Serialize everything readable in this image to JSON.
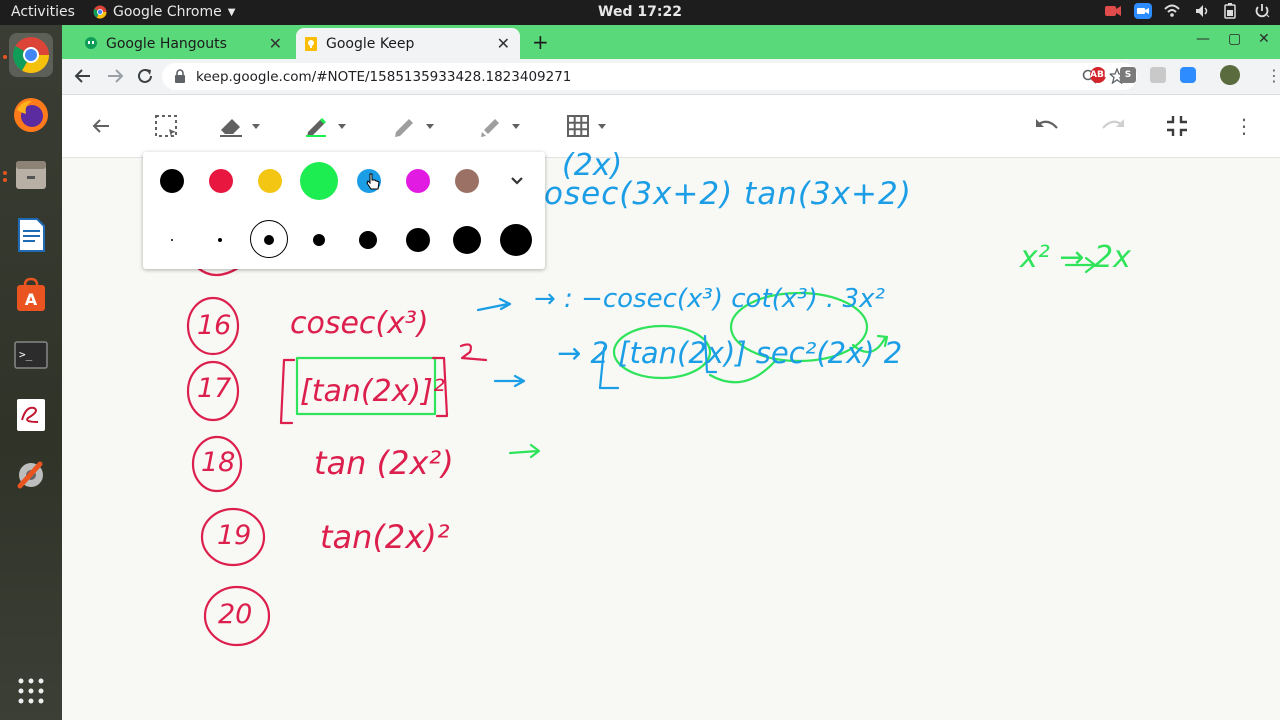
{
  "system": {
    "activities_label": "Activities",
    "app_menu_label": "Google Chrome",
    "clock": "Wed 17:22"
  },
  "browser": {
    "tabs": [
      {
        "title": "Google Hangouts",
        "close": "✕"
      },
      {
        "title": "Google Keep",
        "close": "✕"
      }
    ],
    "new_tab_label": "+",
    "url": "keep.google.com/#NOTE/1585135933428.1823409271",
    "extensions": [
      "ABP",
      "S"
    ]
  },
  "color_picker": {
    "colors": [
      "#000000",
      "#e8173f",
      "#f3c614",
      "#1ded50",
      "#1b9ee6",
      "#e11be1",
      "#9c7165"
    ],
    "selected_color": "#1ded50",
    "stroke_sizes": [
      2,
      4,
      10,
      12,
      18,
      24,
      28,
      32
    ],
    "selected_size_index": 2,
    "expand_icon": "chevron-down-icon"
  },
  "note": {
    "red_lines": [
      {
        "number": "16",
        "expr": "cosec(x³)"
      },
      {
        "number": "17",
        "expr": "[tan(2x)]²"
      },
      {
        "number": "18",
        "expr": "tan (2x²)"
      },
      {
        "number": "19",
        "expr": "tan(2x)²"
      },
      {
        "number": "20",
        "expr": ""
      }
    ],
    "blue_lines": [
      {
        "text": "(2x)"
      },
      {
        "text": "osec(3x+2) tan(3x+2)"
      },
      {
        "text": "→ : −cosec(x³) cot(x³) . 3x²"
      },
      {
        "text": "→ 2 [tan(2x)] sec²(2x) 2"
      }
    ],
    "green_note": "x² → 2x",
    "green_arrow_18": "→"
  }
}
